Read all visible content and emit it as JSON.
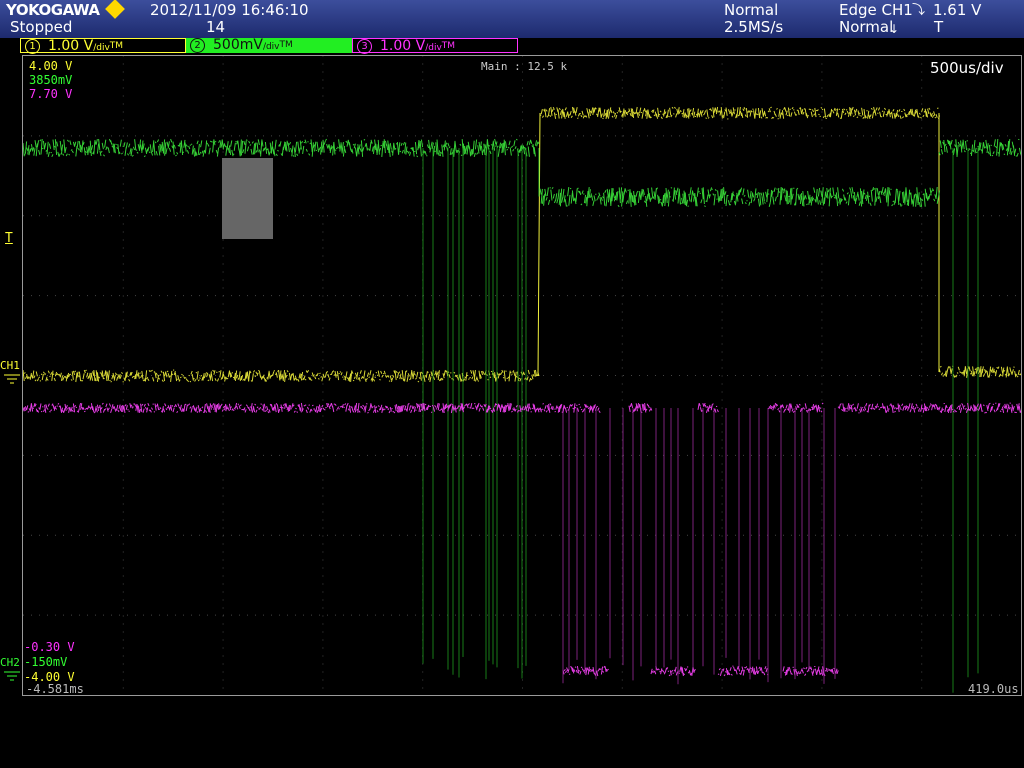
{
  "header": {
    "brand": "YOKOGAWA",
    "status": "Stopped",
    "datetime": "2012/11/09 16:46:10",
    "acq_count": "14",
    "acq_mode": "Normal",
    "sample_rate": "2.5MS/s",
    "trigger_type": "Edge CH1",
    "trigger_level": "1.61 V",
    "trigger_mode": "Normal",
    "trigger_mark": "T"
  },
  "channels": [
    {
      "num": "1",
      "scale": "1.00 V",
      "unit": "/div",
      "suffix": "TM",
      "color": "#ffff33"
    },
    {
      "num": "2",
      "scale": "500mV",
      "unit": "/div",
      "suffix": "TM",
      "color": "#33ff33"
    },
    {
      "num": "3",
      "scale": "1.00 V",
      "unit": "/div",
      "suffix": "TM",
      "color": "#ff33ff"
    }
  ],
  "screen": {
    "main_label": "Main : 12.5 k",
    "timebase": "500us/div",
    "top_ch1": "4.00 V",
    "top_ch2": "3850mV",
    "top_ch3": "7.70 V",
    "bot_ch3": "-0.30 V",
    "bot_ch2": "-150mV",
    "bot_ch1": "-4.00 V",
    "time_left": "-4.581ms",
    "time_right": "419.0us",
    "ch1_marker": "CH1",
    "ch2_marker": "CH2",
    "trig_marker": "T"
  },
  "colors": {
    "ch1": "#f0f03c",
    "ch2": "#3ce83c",
    "ch3": "#ff44ff"
  }
}
